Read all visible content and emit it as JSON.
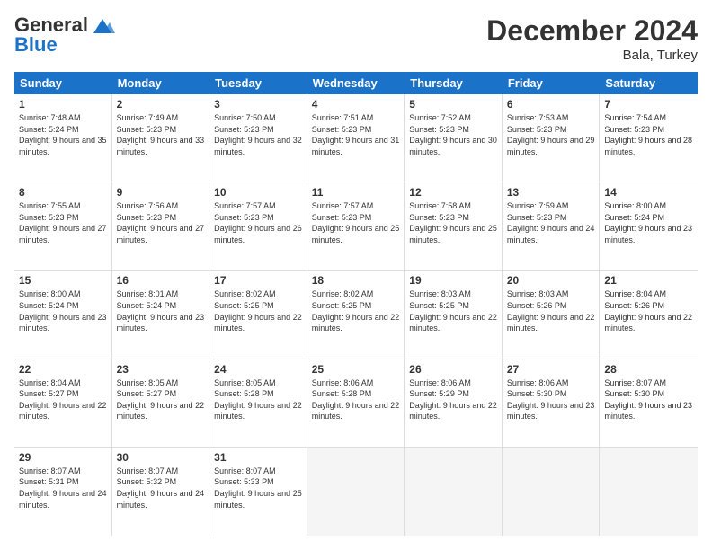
{
  "header": {
    "logo_line1": "General",
    "logo_line2": "Blue",
    "title": "December 2024",
    "location": "Bala, Turkey"
  },
  "days": [
    "Sunday",
    "Monday",
    "Tuesday",
    "Wednesday",
    "Thursday",
    "Friday",
    "Saturday"
  ],
  "weeks": [
    [
      {
        "num": "1",
        "sunrise": "7:48 AM",
        "sunset": "5:24 PM",
        "daylight": "9 hours and 35 minutes."
      },
      {
        "num": "2",
        "sunrise": "7:49 AM",
        "sunset": "5:23 PM",
        "daylight": "9 hours and 33 minutes."
      },
      {
        "num": "3",
        "sunrise": "7:50 AM",
        "sunset": "5:23 PM",
        "daylight": "9 hours and 32 minutes."
      },
      {
        "num": "4",
        "sunrise": "7:51 AM",
        "sunset": "5:23 PM",
        "daylight": "9 hours and 31 minutes."
      },
      {
        "num": "5",
        "sunrise": "7:52 AM",
        "sunset": "5:23 PM",
        "daylight": "9 hours and 30 minutes."
      },
      {
        "num": "6",
        "sunrise": "7:53 AM",
        "sunset": "5:23 PM",
        "daylight": "9 hours and 29 minutes."
      },
      {
        "num": "7",
        "sunrise": "7:54 AM",
        "sunset": "5:23 PM",
        "daylight": "9 hours and 28 minutes."
      }
    ],
    [
      {
        "num": "8",
        "sunrise": "7:55 AM",
        "sunset": "5:23 PM",
        "daylight": "9 hours and 27 minutes."
      },
      {
        "num": "9",
        "sunrise": "7:56 AM",
        "sunset": "5:23 PM",
        "daylight": "9 hours and 27 minutes."
      },
      {
        "num": "10",
        "sunrise": "7:57 AM",
        "sunset": "5:23 PM",
        "daylight": "9 hours and 26 minutes."
      },
      {
        "num": "11",
        "sunrise": "7:57 AM",
        "sunset": "5:23 PM",
        "daylight": "9 hours and 25 minutes."
      },
      {
        "num": "12",
        "sunrise": "7:58 AM",
        "sunset": "5:23 PM",
        "daylight": "9 hours and 25 minutes."
      },
      {
        "num": "13",
        "sunrise": "7:59 AM",
        "sunset": "5:23 PM",
        "daylight": "9 hours and 24 minutes."
      },
      {
        "num": "14",
        "sunrise": "8:00 AM",
        "sunset": "5:24 PM",
        "daylight": "9 hours and 23 minutes."
      }
    ],
    [
      {
        "num": "15",
        "sunrise": "8:00 AM",
        "sunset": "5:24 PM",
        "daylight": "9 hours and 23 minutes."
      },
      {
        "num": "16",
        "sunrise": "8:01 AM",
        "sunset": "5:24 PM",
        "daylight": "9 hours and 23 minutes."
      },
      {
        "num": "17",
        "sunrise": "8:02 AM",
        "sunset": "5:25 PM",
        "daylight": "9 hours and 22 minutes."
      },
      {
        "num": "18",
        "sunrise": "8:02 AM",
        "sunset": "5:25 PM",
        "daylight": "9 hours and 22 minutes."
      },
      {
        "num": "19",
        "sunrise": "8:03 AM",
        "sunset": "5:25 PM",
        "daylight": "9 hours and 22 minutes."
      },
      {
        "num": "20",
        "sunrise": "8:03 AM",
        "sunset": "5:26 PM",
        "daylight": "9 hours and 22 minutes."
      },
      {
        "num": "21",
        "sunrise": "8:04 AM",
        "sunset": "5:26 PM",
        "daylight": "9 hours and 22 minutes."
      }
    ],
    [
      {
        "num": "22",
        "sunrise": "8:04 AM",
        "sunset": "5:27 PM",
        "daylight": "9 hours and 22 minutes."
      },
      {
        "num": "23",
        "sunrise": "8:05 AM",
        "sunset": "5:27 PM",
        "daylight": "9 hours and 22 minutes."
      },
      {
        "num": "24",
        "sunrise": "8:05 AM",
        "sunset": "5:28 PM",
        "daylight": "9 hours and 22 minutes."
      },
      {
        "num": "25",
        "sunrise": "8:06 AM",
        "sunset": "5:28 PM",
        "daylight": "9 hours and 22 minutes."
      },
      {
        "num": "26",
        "sunrise": "8:06 AM",
        "sunset": "5:29 PM",
        "daylight": "9 hours and 22 minutes."
      },
      {
        "num": "27",
        "sunrise": "8:06 AM",
        "sunset": "5:30 PM",
        "daylight": "9 hours and 23 minutes."
      },
      {
        "num": "28",
        "sunrise": "8:07 AM",
        "sunset": "5:30 PM",
        "daylight": "9 hours and 23 minutes."
      }
    ],
    [
      {
        "num": "29",
        "sunrise": "8:07 AM",
        "sunset": "5:31 PM",
        "daylight": "9 hours and 24 minutes."
      },
      {
        "num": "30",
        "sunrise": "8:07 AM",
        "sunset": "5:32 PM",
        "daylight": "9 hours and 24 minutes."
      },
      {
        "num": "31",
        "sunrise": "8:07 AM",
        "sunset": "5:33 PM",
        "daylight": "9 hours and 25 minutes."
      },
      null,
      null,
      null,
      null
    ]
  ]
}
